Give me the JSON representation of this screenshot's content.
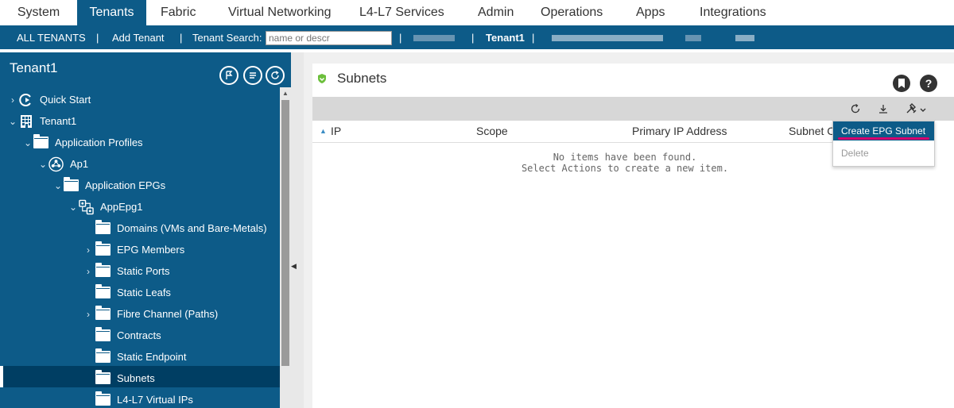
{
  "top_menu": {
    "items": [
      "System",
      "Tenants",
      "Fabric",
      "Virtual Networking",
      "L4-L7 Services",
      "Admin",
      "Operations",
      "Apps",
      "Integrations"
    ],
    "active": "Tenants"
  },
  "sub_bar": {
    "all_tenants": "ALL TENANTS",
    "add_tenant": "Add Tenant",
    "tenant_search_label": "Tenant Search:",
    "search_placeholder": "name or descr",
    "current_tenant": "Tenant1",
    "separator": "|"
  },
  "left_pane": {
    "title": "Tenant1",
    "tree": [
      {
        "label": "Quick Start",
        "icon": "quick-start-icon"
      },
      {
        "label": "Tenant1",
        "icon": "tenant-icon"
      },
      {
        "label": "Application Profiles",
        "icon": "folder-icon"
      },
      {
        "label": "Ap1",
        "icon": "app-profile-icon"
      },
      {
        "label": "Application EPGs",
        "icon": "folder-icon"
      },
      {
        "label": "AppEpg1",
        "icon": "epg-icon"
      },
      {
        "label": "Domains (VMs and Bare-Metals)",
        "icon": "folder-icon"
      },
      {
        "label": "EPG Members",
        "icon": "folder-icon"
      },
      {
        "label": "Static Ports",
        "icon": "folder-icon"
      },
      {
        "label": "Static Leafs",
        "icon": "folder-icon"
      },
      {
        "label": "Fibre Channel (Paths)",
        "icon": "folder-icon"
      },
      {
        "label": "Contracts",
        "icon": "folder-icon"
      },
      {
        "label": "Static Endpoint",
        "icon": "folder-icon"
      },
      {
        "label": "Subnets",
        "icon": "folder-icon"
      },
      {
        "label": "L4-L7 Virtual IPs",
        "icon": "folder-icon"
      }
    ],
    "selected": "Subnets"
  },
  "main": {
    "title": "Subnets",
    "columns": [
      "IP",
      "Scope",
      "Primary IP Address",
      "Subnet C"
    ],
    "empty_line1": "No items have been found.",
    "empty_line2": "Select Actions to create a new item.",
    "help_icon": "?",
    "actions_menu": {
      "items": [
        "Create EPG Subnet",
        "Delete"
      ]
    }
  },
  "colors": {
    "nav_blue": "#0d5b88",
    "selected_row": "#003e63",
    "highlight_underline": "#d6006e",
    "shield_green": "#6cbf3c"
  }
}
